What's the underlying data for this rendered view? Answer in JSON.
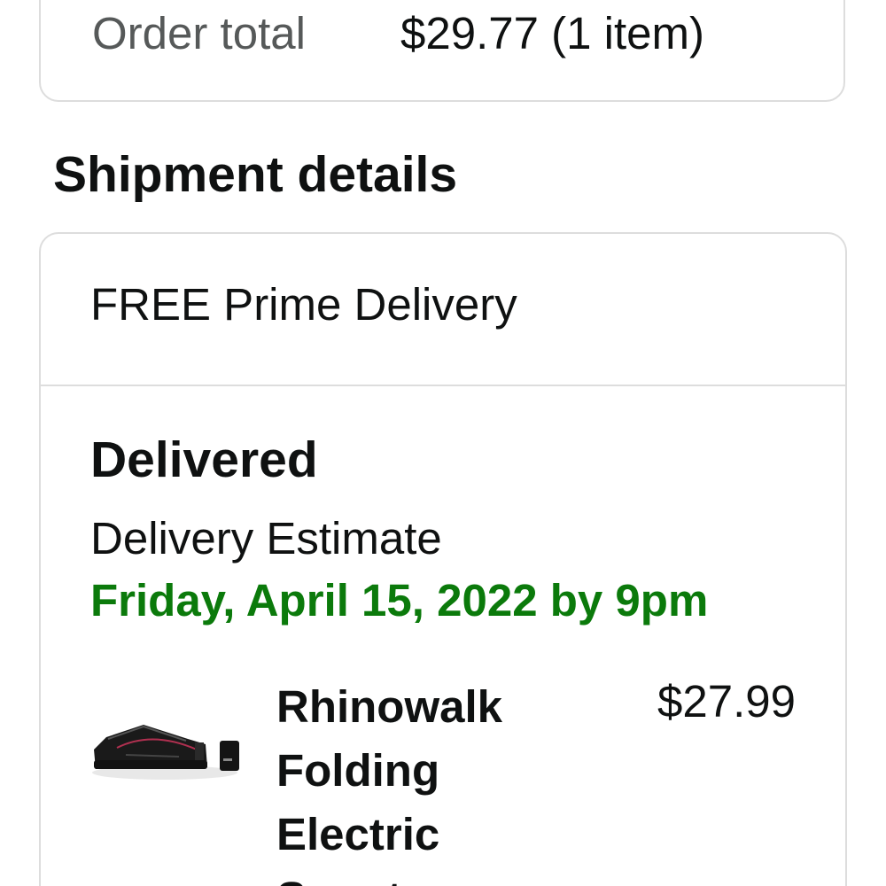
{
  "order_summary": {
    "total_label": "Order total",
    "total_value": "$29.77 (1 item)"
  },
  "shipment": {
    "section_title": "Shipment details",
    "delivery_type": "FREE Prime Delivery",
    "status": "Delivered",
    "estimate_label": "Delivery Estimate",
    "estimate_date": "Friday, April 15, 2022 by 9pm",
    "estimate_color": "#0b7a0b",
    "item": {
      "title": "Rhinowalk Folding Electric Scooter",
      "price": "$27.99",
      "image_icon": "scooter-bag-product-image"
    }
  }
}
